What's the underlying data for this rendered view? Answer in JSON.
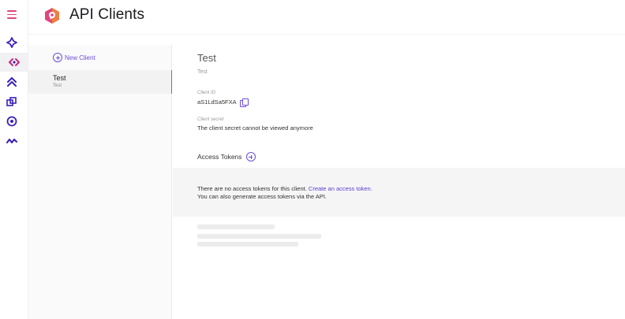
{
  "header": {
    "title": "API Clients"
  },
  "rail": {
    "items": [
      "menu-icon",
      "workflow-icon",
      "api-icon",
      "chevrons-up-icon",
      "stack-icon",
      "target-icon",
      "activity-icon"
    ]
  },
  "list": {
    "new_client_label": "New Client",
    "clients": [
      {
        "name": "Test",
        "description": "Test"
      }
    ]
  },
  "detail": {
    "title": "Test",
    "description": "Test",
    "client_id_label": "Client ID",
    "client_id": "aS1LdSa5FXA",
    "client_secret_label": "Client secret",
    "client_secret_text": "The client secret cannot be viewed anymore",
    "access_tokens_label": "Access Tokens",
    "empty_line1": "There are no access tokens for this client.",
    "empty_link": "Create an access token.",
    "empty_line2": "You can also generate access tokens via the API."
  },
  "colors": {
    "accent": "#6b4dd6",
    "brand": "#e0457b",
    "rail_icons": "#3b1fb8"
  }
}
